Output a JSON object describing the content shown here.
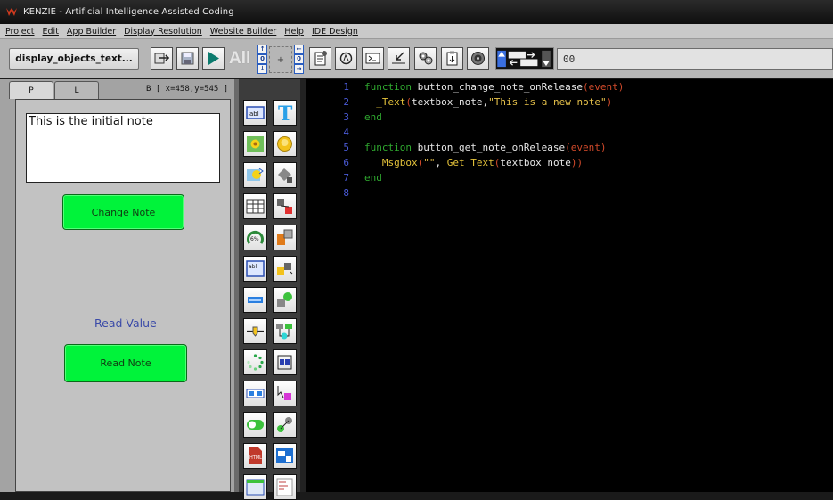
{
  "window": {
    "title": "KENZIE - Artificial Intelligence Assisted Coding"
  },
  "menu": [
    "Project",
    "Edit",
    "App Builder",
    "Display Resolution",
    "Website Builder",
    "Help",
    "IDE Design"
  ],
  "toolbar": {
    "document_name": "display_objects_text...",
    "all_label": "All",
    "nudge_center": "+",
    "nudge_up": "↑",
    "nudge_down": "↓",
    "nudge_left": "←",
    "nudge_right": "→",
    "nudge_zero": "0",
    "coord_value": "00"
  },
  "left_panel": {
    "tab_p": "P",
    "tab_l": "L",
    "coords": "B [ x=458,y=545 ]"
  },
  "canvas": {
    "note_text": "This is the initial note",
    "change_button": "Change Note",
    "read_label": "Read Value",
    "read_button": "Read Note"
  },
  "palette": {
    "label_icon": "abl",
    "text_icon": "T",
    "html_icon": "HTML",
    "percent_icon": "6%"
  },
  "editor": {
    "line_numbers": [
      "1",
      "2",
      "3",
      "4",
      "5",
      "6",
      "7",
      "8"
    ],
    "l1": {
      "kw": "function",
      "name": " button_change_note_onRelease",
      "open": "(",
      "arg": "event",
      "close": ")"
    },
    "l2": {
      "indent": "  ",
      "fn": "_Text",
      "open": "(",
      "a1": "textbox_note",
      "comma": ",",
      "str": "\"This is a new note\"",
      "close": ")"
    },
    "l3": {
      "kw": "end"
    },
    "l5": {
      "kw": "function",
      "name": " button_get_note_onRelease",
      "open": "(",
      "arg": "event",
      "close": ")"
    },
    "l6": {
      "indent": "  ",
      "fn": "_Msgbox",
      "open": "(",
      "str": "\"\"",
      "comma": ",",
      "fn2": "_Get_Text",
      "open2": "(",
      "a1": "textbox_note",
      "close2": ")",
      "close": ")"
    },
    "l7": {
      "kw": "end"
    }
  }
}
